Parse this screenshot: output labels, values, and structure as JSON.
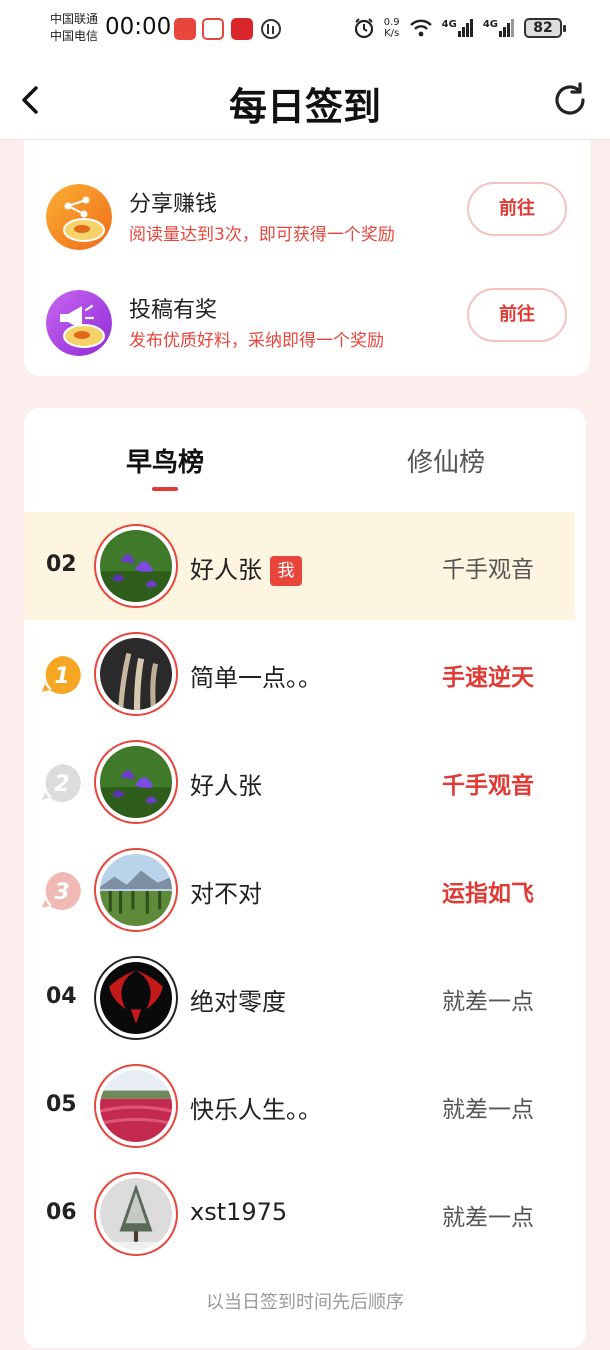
{
  "status_bar": {
    "carrier_1": "中国联通",
    "carrier_2": "中国电信",
    "time": "00:00",
    "net_speed_value": "0.9",
    "net_speed_unit": "K/s",
    "signal_1": "4G",
    "signal_2": "4G",
    "battery": "82"
  },
  "nav": {
    "title": "每日签到",
    "back_icon": "chevron-left-icon",
    "refresh_icon": "refresh-icon"
  },
  "tasks": [
    {
      "title": "分享赚钱",
      "desc": "阅读量达到3次，即可获得一个奖励",
      "button": "前往",
      "icon": "share-icon",
      "color": "#f59a1e"
    },
    {
      "title": "投稿有奖",
      "desc": "发布优质好料，采纳即得一个奖励",
      "button": "前往",
      "icon": "megaphone-icon",
      "color": "#b44de6"
    }
  ],
  "tabs": [
    {
      "label": "早鸟榜",
      "active": true
    },
    {
      "label": "修仙榜",
      "active": false
    }
  ],
  "ranking": {
    "mine": {
      "rank": "02",
      "name": "好人张",
      "badge": "我",
      "title": "千手观音"
    },
    "rows": [
      {
        "rank": "1",
        "name": "简单一点。。",
        "title": "手速逆天",
        "highlight": true
      },
      {
        "rank": "2",
        "name": "好人张",
        "title": "千手观音",
        "highlight": true
      },
      {
        "rank": "3",
        "name": "对不对",
        "title": "运指如飞",
        "highlight": true
      },
      {
        "rank": "04",
        "name": "绝对零度",
        "title": "就差一点",
        "highlight": false
      },
      {
        "rank": "05",
        "name": "快乐人生。。",
        "title": "就差一点",
        "highlight": false
      },
      {
        "rank": "06",
        "name": "xst1975",
        "title": "就差一点",
        "highlight": false
      }
    ],
    "footer": "以当日签到时间先后顺序"
  },
  "colors": {
    "accent": "#e03a34",
    "gold": "#f5a623",
    "silver": "#d6d6d6",
    "bronze": "#f0b9b4"
  }
}
